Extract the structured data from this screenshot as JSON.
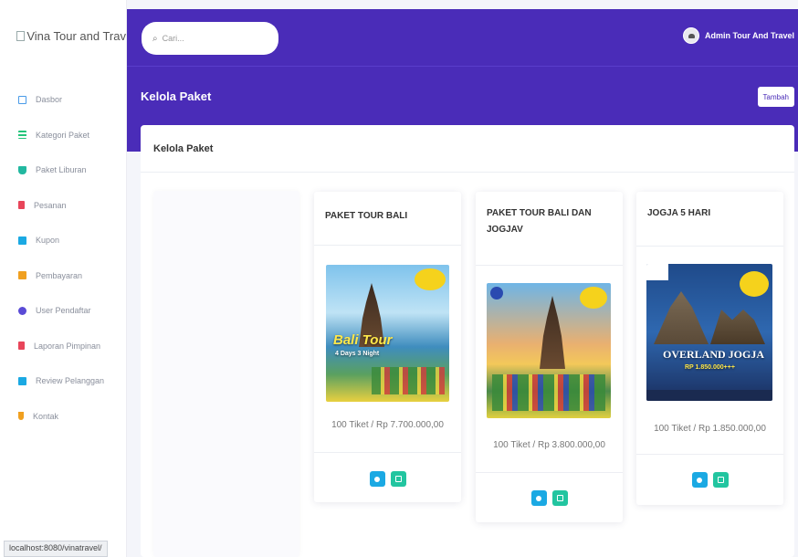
{
  "brand": {
    "logo_alt": "Vina Tour and Trav"
  },
  "sidebar": {
    "items": [
      {
        "label": "Dasbor",
        "icon": "monitor-icon",
        "color": "#4a9be8"
      },
      {
        "label": "Kategori Paket",
        "icon": "list-icon",
        "color": "#22c57a"
      },
      {
        "label": "Paket Liburan",
        "icon": "cart-icon",
        "color": "#22b8a0"
      },
      {
        "label": "Pesanan",
        "icon": "file-icon",
        "color": "#e8455a"
      },
      {
        "label": "Kupon",
        "icon": "ticket-icon",
        "color": "#1ba9e3"
      },
      {
        "label": "Pembayaran",
        "icon": "money-icon",
        "color": "#f0a020"
      },
      {
        "label": "User Pendaftar",
        "icon": "users-icon",
        "color": "#5a4bd6"
      },
      {
        "label": "Laporan Pimpinan",
        "icon": "report-icon",
        "color": "#e8455a"
      },
      {
        "label": "Review Pelanggan",
        "icon": "edit-icon",
        "color": "#1ba9e3"
      },
      {
        "label": "Kontak",
        "icon": "phone-icon",
        "color": "#f0a020"
      }
    ]
  },
  "status_bar": {
    "url": "localhost:8080/vinatravel/"
  },
  "topbar": {
    "search_placeholder": "Cari...",
    "user_name": "Admin Tour And Travel"
  },
  "header": {
    "title": "Kelola Paket",
    "add_label": "Tambah"
  },
  "panel": {
    "title": "Kelola Paket"
  },
  "packages": [
    {
      "title": "PAKET TOUR BALI",
      "price": "100 Tiket / Rp 7.700.000,00",
      "poster_text": "Bali Tour",
      "poster_sub": "4 Days 3 Night"
    },
    {
      "title": "PAKET TOUR BALI DAN JOGJAV",
      "price": "100 Tiket / Rp 3.800.000,00",
      "poster_text": "",
      "poster_sub": ""
    },
    {
      "title": "JOGJA 5 HARI",
      "price": "100 Tiket / Rp 1.850.000,00",
      "poster_text": "OVERLAND JOGJA",
      "poster_sub": "RP 1.850.000+++"
    }
  ],
  "colors": {
    "primary": "#4a2cb8",
    "view_button": "#1ba9e3",
    "edit_button": "#22c5a0"
  }
}
